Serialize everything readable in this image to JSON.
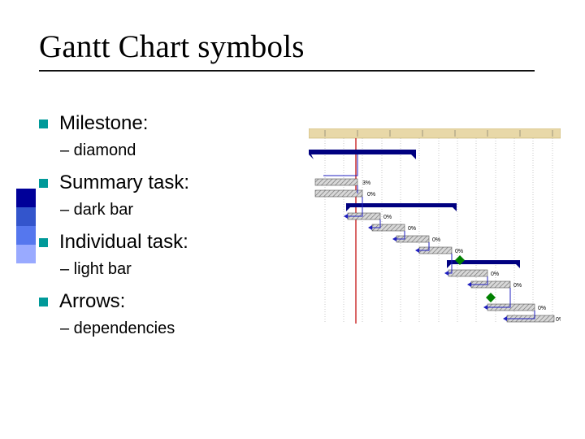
{
  "title": "Gantt Chart symbols",
  "accent_colors": [
    "#000099",
    "#3355cc",
    "#5577ee",
    "#99aaff"
  ],
  "items": [
    {
      "label": "Milestone:",
      "sub": "– diamond"
    },
    {
      "label": "Summary task:",
      "sub": "– dark bar"
    },
    {
      "label": "Individual task:",
      "sub": "– light bar"
    },
    {
      "label": "Arrows:",
      "sub": "– dependencies"
    }
  ],
  "gantt": {
    "header_bg": "#e8d8a8",
    "grid_color": "#dddddd",
    "summary_color": "#000080",
    "today_line_color": "#c00000",
    "task_fill": "#cccccc",
    "task_hatch": "#888888",
    "milestone_color": "#008000",
    "percent_label": "0%",
    "percent_label_alt": "3%"
  }
}
